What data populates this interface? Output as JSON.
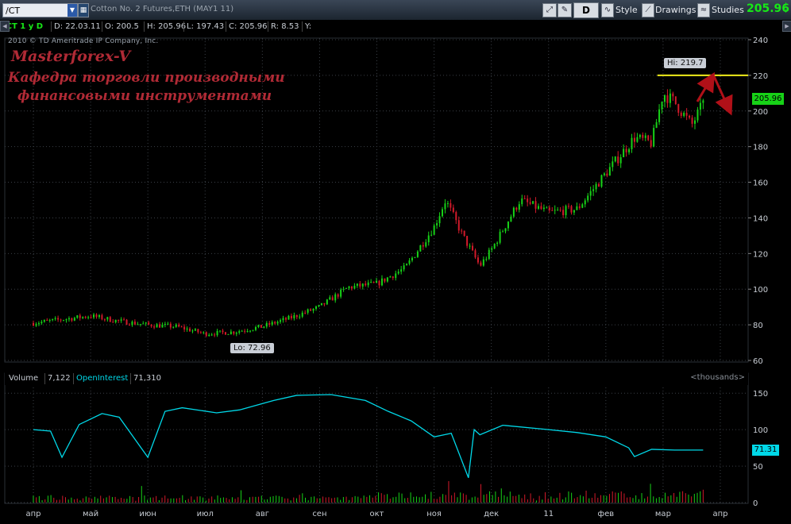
{
  "toolbar": {
    "symbol": "/CT",
    "description": "Cotton No. 2 Futures,ETH (MAY1 11)",
    "period_button": "D",
    "style_label": "Style",
    "drawings_label": "Drawings",
    "studies_label": "Studies",
    "last_price": "205.96",
    "mini_change": "+\n+"
  },
  "infobar": {
    "symbol_period": "/CT 1 y D",
    "date": "D: 22.03.11",
    "open": "O: 200.5",
    "high": "H: 205.96",
    "low": "L: 197.43",
    "close": "C: 205.96",
    "range": "R: 8.53",
    "y": "Y:"
  },
  "copyright": "2010 © TD Ameritrade IP Company, Inc.",
  "watermark": {
    "line1": "Masterforex-V",
    "line2": "Кафедра торговли производными",
    "line3": "финансовыми инструментами"
  },
  "price_tag": "205.96",
  "oi_tag": "71.31",
  "hi_label": "Hi: 219.7",
  "lo_label": "Lo: 72.96",
  "lower": {
    "volume_label": "Volume",
    "volume_value": "7,122",
    "oi_label": "OpenInterest",
    "oi_value": "71,310",
    "units": "<thousands>"
  },
  "colors": {
    "up": "#17d217",
    "down": "#d21a2a",
    "oi_line": "#00d8e8",
    "resistance": "#f0ec1a",
    "arrow": "#b01018",
    "grid": "#3a3f46"
  },
  "chart_data": [
    {
      "type": "candlestick",
      "title": "",
      "ylim": [
        60,
        240
      ],
      "y_ticks": [
        60,
        80,
        100,
        120,
        140,
        160,
        180,
        200,
        220,
        240
      ],
      "x_ticks": [
        "апр",
        "май",
        "июн",
        "июл",
        "авг",
        "сен",
        "окт",
        "ноя",
        "дек",
        "11",
        "фев",
        "мар",
        "апр"
      ],
      "hi": 219.7,
      "lo": 72.96,
      "last": 205.96,
      "resistance_level": 220,
      "close_path_months": [
        0,
        0.5,
        1,
        1.5,
        2,
        2.5,
        3,
        3.5,
        4,
        4.5,
        5,
        5.5,
        6,
        6.5,
        7,
        7.2,
        7.5,
        7.8,
        8,
        8.5,
        9,
        9.5,
        10,
        10.5,
        10.8,
        11,
        11.2,
        11.5,
        11.7
      ],
      "close_path_values": [
        81,
        83,
        85,
        82,
        80,
        79,
        75,
        76,
        79,
        84,
        90,
        101,
        103,
        112,
        135,
        150,
        130,
        113,
        122,
        150,
        143,
        145,
        165,
        185,
        182,
        210,
        205,
        192,
        204
      ]
    },
    {
      "type": "line",
      "title": "",
      "ylim": [
        0,
        160
      ],
      "y_ticks": [
        0,
        50,
        100,
        150
      ],
      "series": [
        {
          "name": "OpenInterest",
          "x_months": [
            0,
            0.3,
            0.5,
            0.8,
            1.2,
            1.5,
            2.0,
            2.3,
            2.6,
            3.2,
            3.6,
            4.2,
            4.6,
            5.2,
            5.8,
            6.2,
            6.6,
            7.0,
            7.3,
            7.6,
            7.7,
            7.8,
            8.2,
            9.0,
            9.5,
            10.0,
            10.4,
            10.5,
            10.8,
            11.2,
            11.7
          ],
          "values": [
            100,
            98,
            62,
            107,
            122,
            117,
            62,
            125,
            130,
            123,
            127,
            140,
            147,
            148,
            140,
            125,
            112,
            90,
            95,
            34,
            100,
            93,
            106,
            100,
            96,
            90,
            75,
            63,
            73,
            72,
            72
          ]
        },
        {
          "name": "Volume",
          "max": 40
        }
      ]
    }
  ]
}
